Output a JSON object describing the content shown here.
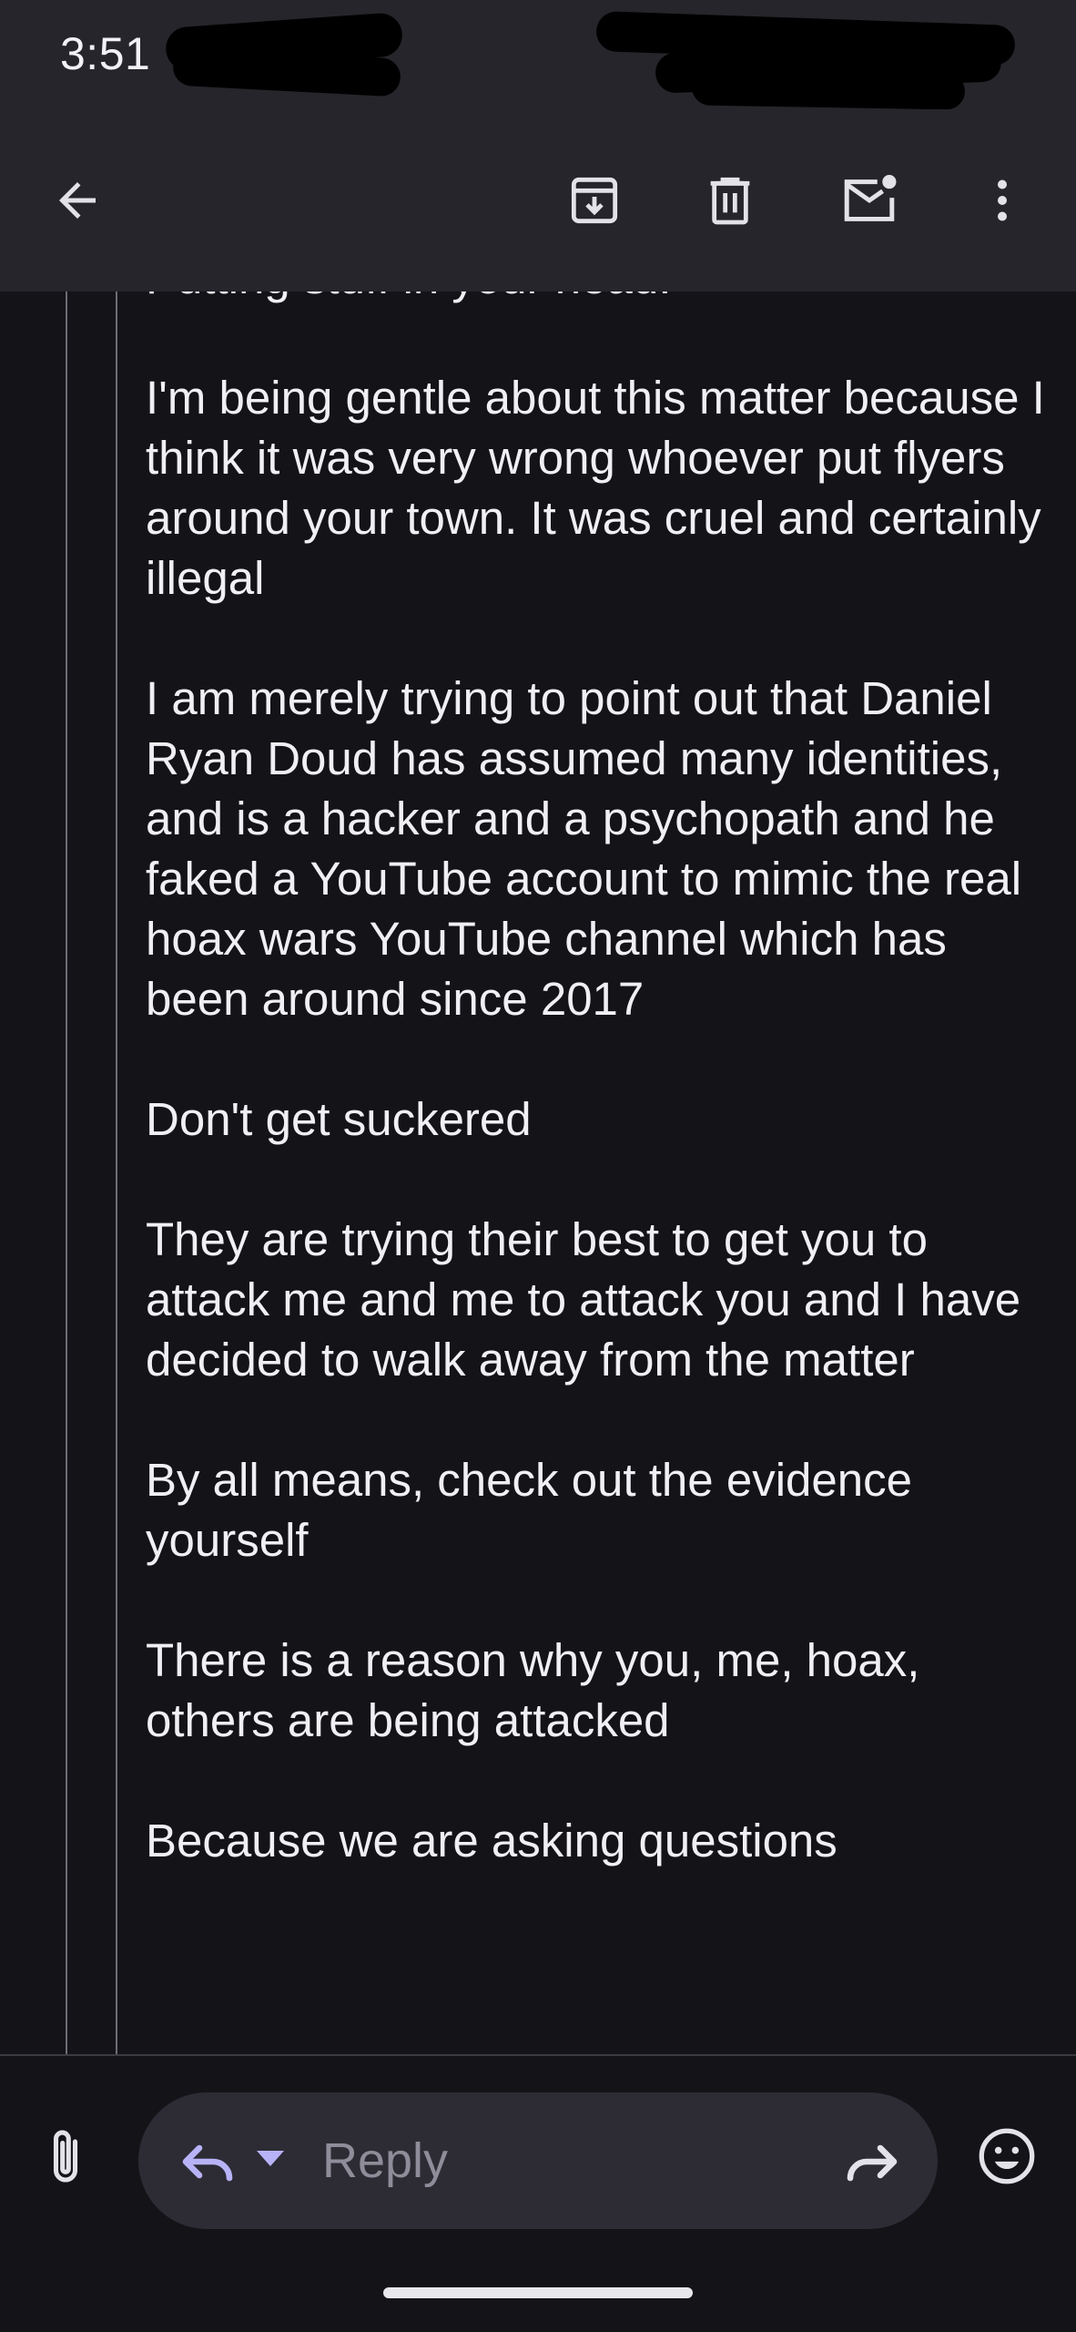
{
  "status_bar": {
    "time": "3:51"
  },
  "toolbar": {
    "back_icon": "arrow-left-icon",
    "archive_icon": "archive-icon",
    "delete_icon": "trash-icon",
    "mark_unread_icon": "mail-unread-icon",
    "more_icon": "more-vert-icon"
  },
  "message": {
    "paragraphs": [
      "Putting stuff in your head.",
      "I'm being gentle about this matter because I think it was very wrong whoever put flyers around your town. It was cruel and certainly illegal",
      "I am merely trying to point out that Daniel Ryan Doud has assumed many identities, and is a hacker and a psychopath and he faked a YouTube account to mimic the real hoax wars YouTube channel which has been around since 2017",
      "Don't get suckered",
      "They are trying their best to get you to attack me and me to attack you and I have decided to walk away from the matter",
      "By all means, check out the evidence yourself",
      "There is a reason why you, me, hoax, others are being attacked",
      "Because we are asking questions"
    ]
  },
  "reply_bar": {
    "attach_icon": "paperclip-icon",
    "reply_icon": "reply-icon",
    "reply_placeholder": "Reply",
    "forward_icon": "forward-icon",
    "emoji_icon": "emoji-icon"
  },
  "colors": {
    "background": "#141318",
    "toolbar": "#26252b",
    "accent": "#b8b3f7",
    "text": "#f0eff4"
  }
}
